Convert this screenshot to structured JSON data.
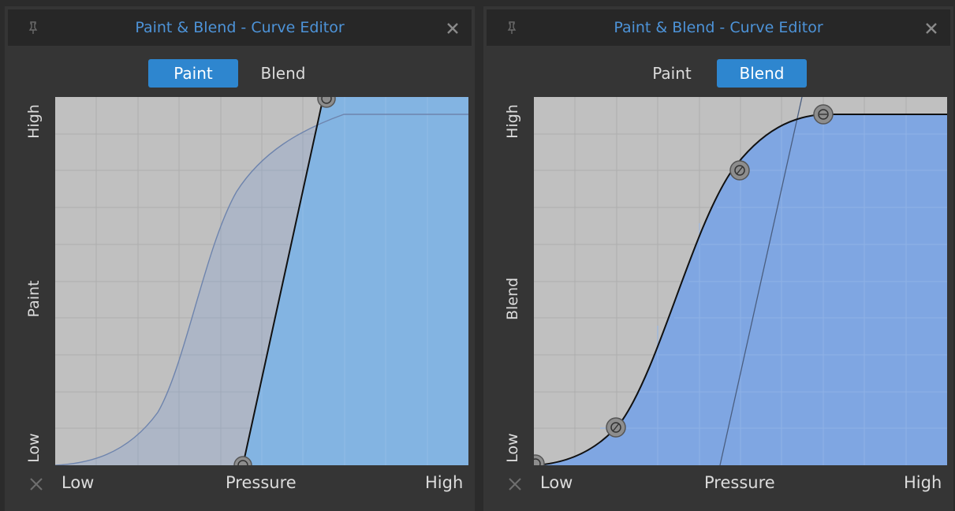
{
  "panels": [
    {
      "title": "Paint & Blend - Curve Editor",
      "tabs": [
        {
          "label": "Paint",
          "active": true
        },
        {
          "label": "Blend",
          "active": false
        }
      ],
      "y_axis": {
        "high": "High",
        "mid": "Paint",
        "low": "Low"
      },
      "x_axis": {
        "low": "Low",
        "mid": "Pressure",
        "high": "High"
      },
      "active_curve": "linear-ramp",
      "icons": {
        "pin": "pin-icon",
        "close": "close-icon",
        "reset": "x-icon"
      }
    },
    {
      "title": "Paint & Blend - Curve Editor",
      "tabs": [
        {
          "label": "Paint",
          "active": false
        },
        {
          "label": "Blend",
          "active": true
        }
      ],
      "y_axis": {
        "high": "High",
        "mid": "Blend",
        "low": "Low"
      },
      "x_axis": {
        "low": "Low",
        "mid": "Pressure",
        "high": "High"
      },
      "active_curve": "s-curve",
      "icons": {
        "pin": "pin-icon",
        "close": "close-icon",
        "reset": "x-icon"
      }
    }
  ],
  "colors": {
    "panel_bg": "#353535",
    "titlebar_bg": "#272727",
    "title_text": "#4d93d8",
    "tab_active": "#2e86cf",
    "graph_bg": "#c0c0c0",
    "paint_fill": "#83b4e2",
    "blend_fill": "#7fa6e2"
  }
}
